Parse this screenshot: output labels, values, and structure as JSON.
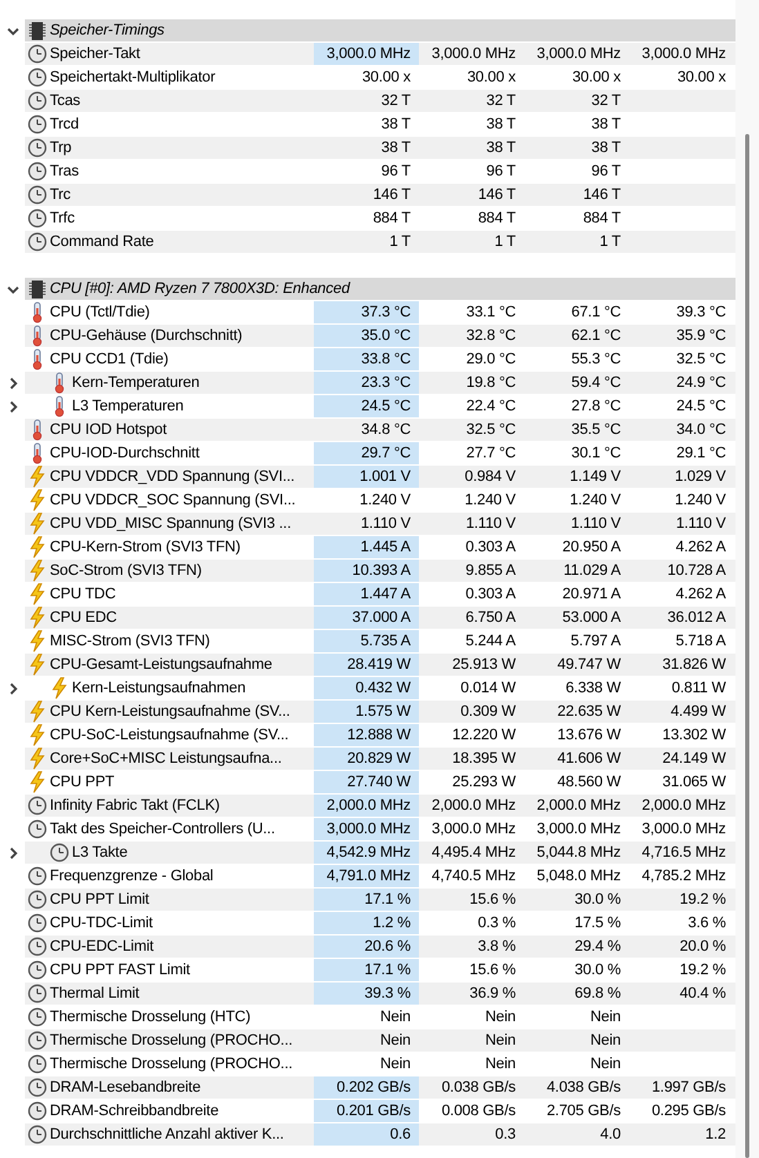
{
  "sections": [
    {
      "title": "Speicher-Timings",
      "expanded": true,
      "rows": [
        {
          "kind": "clock",
          "label": "Speicher-Takt",
          "highlighted": true,
          "values": [
            "3,000.0 MHz",
            "3,000.0 MHz",
            "3,000.0 MHz",
            "3,000.0 MHz"
          ]
        },
        {
          "kind": "clock",
          "label": "Speichertakt-Multiplikator",
          "highlighted": false,
          "values": [
            "30.00 x",
            "30.00 x",
            "30.00 x",
            "30.00 x"
          ]
        },
        {
          "kind": "clock",
          "label": "Tcas",
          "highlighted": false,
          "values": [
            "32 T",
            "32 T",
            "32 T"
          ]
        },
        {
          "kind": "clock",
          "label": "Trcd",
          "highlighted": false,
          "values": [
            "38 T",
            "38 T",
            "38 T"
          ]
        },
        {
          "kind": "clock",
          "label": "Trp",
          "highlighted": false,
          "values": [
            "38 T",
            "38 T",
            "38 T"
          ]
        },
        {
          "kind": "clock",
          "label": "Tras",
          "highlighted": false,
          "values": [
            "96 T",
            "96 T",
            "96 T"
          ]
        },
        {
          "kind": "clock",
          "label": "Trc",
          "highlighted": false,
          "values": [
            "146 T",
            "146 T",
            "146 T"
          ]
        },
        {
          "kind": "clock",
          "label": "Trfc",
          "highlighted": false,
          "values": [
            "884 T",
            "884 T",
            "884 T"
          ]
        },
        {
          "kind": "clock",
          "label": "Command Rate",
          "highlighted": false,
          "values": [
            "1 T",
            "1 T",
            "1 T"
          ]
        }
      ]
    },
    {
      "title": "CPU [#0]: AMD Ryzen 7 7800X3D: Enhanced",
      "expanded": true,
      "rows": [
        {
          "kind": "temp",
          "label": "CPU (Tctl/Tdie)",
          "highlighted": true,
          "values": [
            "37.3 °C",
            "33.1 °C",
            "67.1 °C",
            "39.3 °C"
          ]
        },
        {
          "kind": "temp",
          "label": "CPU-Gehäuse (Durchschnitt)",
          "highlighted": true,
          "values": [
            "35.0 °C",
            "32.8 °C",
            "62.1 °C",
            "35.9 °C"
          ]
        },
        {
          "kind": "temp",
          "label": "CPU CCD1 (Tdie)",
          "highlighted": true,
          "values": [
            "33.8 °C",
            "29.0 °C",
            "55.3 °C",
            "32.5 °C"
          ]
        },
        {
          "kind": "temp",
          "label": "Kern-Temperaturen",
          "highlighted": true,
          "expanded": false,
          "values": [
            "23.3 °C",
            "19.8 °C",
            "59.4 °C",
            "24.9 °C"
          ]
        },
        {
          "kind": "temp",
          "label": "L3 Temperaturen",
          "highlighted": true,
          "expanded": false,
          "values": [
            "24.5 °C",
            "22.4 °C",
            "27.8 °C",
            "24.5 °C"
          ]
        },
        {
          "kind": "temp",
          "label": "CPU IOD Hotspot",
          "highlighted": false,
          "values": [
            "34.8 °C",
            "32.5 °C",
            "35.5 °C",
            "34.0 °C"
          ]
        },
        {
          "kind": "temp",
          "label": "CPU-IOD-Durchschnitt",
          "highlighted": true,
          "values": [
            "29.7 °C",
            "27.7 °C",
            "30.1 °C",
            "29.1 °C"
          ]
        },
        {
          "kind": "power",
          "label": "CPU VDDCR_VDD Spannung (SVI...",
          "highlighted": true,
          "values": [
            "1.001 V",
            "0.984 V",
            "1.149 V",
            "1.029 V"
          ]
        },
        {
          "kind": "power",
          "label": "CPU VDDCR_SOC Spannung (SVI...",
          "highlighted": false,
          "values": [
            "1.240 V",
            "1.240 V",
            "1.240 V",
            "1.240 V"
          ]
        },
        {
          "kind": "power",
          "label": "CPU VDD_MISC Spannung (SVI3 ...",
          "highlighted": false,
          "values": [
            "1.110 V",
            "1.110 V",
            "1.110 V",
            "1.110 V"
          ]
        },
        {
          "kind": "power",
          "label": "CPU-Kern-Strom (SVI3 TFN)",
          "highlighted": true,
          "values": [
            "1.445 A",
            "0.303 A",
            "20.950 A",
            "4.262 A"
          ]
        },
        {
          "kind": "power",
          "label": "SoC-Strom (SVI3 TFN)",
          "highlighted": true,
          "values": [
            "10.393 A",
            "9.855 A",
            "11.029 A",
            "10.728 A"
          ]
        },
        {
          "kind": "power",
          "label": "CPU TDC",
          "highlighted": true,
          "values": [
            "1.447 A",
            "0.303 A",
            "20.971 A",
            "4.262 A"
          ]
        },
        {
          "kind": "power",
          "label": "CPU EDC",
          "highlighted": true,
          "values": [
            "37.000 A",
            "6.750 A",
            "53.000 A",
            "36.012 A"
          ]
        },
        {
          "kind": "power",
          "label": "MISC-Strom (SVI3 TFN)",
          "highlighted": true,
          "values": [
            "5.735 A",
            "5.244 A",
            "5.797 A",
            "5.718 A"
          ]
        },
        {
          "kind": "power",
          "label": "CPU-Gesamt-Leistungsaufnahme",
          "highlighted": true,
          "values": [
            "28.419 W",
            "25.913 W",
            "49.747 W",
            "31.826 W"
          ]
        },
        {
          "kind": "power",
          "label": "Kern-Leistungsaufnahmen",
          "highlighted": true,
          "expanded": false,
          "values": [
            "0.432 W",
            "0.014 W",
            "6.338 W",
            "0.811 W"
          ]
        },
        {
          "kind": "power",
          "label": "CPU Kern-Leistungsaufnahme (SV...",
          "highlighted": true,
          "values": [
            "1.575 W",
            "0.309 W",
            "22.635 W",
            "4.499 W"
          ]
        },
        {
          "kind": "power",
          "label": "CPU-SoC-Leistungsaufnahme (SV...",
          "highlighted": true,
          "values": [
            "12.888 W",
            "12.220 W",
            "13.676 W",
            "13.302 W"
          ]
        },
        {
          "kind": "power",
          "label": "Core+SoC+MISC Leistungsaufna...",
          "highlighted": true,
          "values": [
            "20.829 W",
            "18.395 W",
            "41.606 W",
            "24.149 W"
          ]
        },
        {
          "kind": "power",
          "label": "CPU PPT",
          "highlighted": true,
          "values": [
            "27.740 W",
            "25.293 W",
            "48.560 W",
            "31.065 W"
          ]
        },
        {
          "kind": "clock",
          "label": "Infinity Fabric Takt (FCLK)",
          "highlighted": true,
          "values": [
            "2,000.0 MHz",
            "2,000.0 MHz",
            "2,000.0 MHz",
            "2,000.0 MHz"
          ]
        },
        {
          "kind": "clock",
          "label": "Takt des Speicher-Controllers (U...",
          "highlighted": true,
          "values": [
            "3,000.0 MHz",
            "3,000.0 MHz",
            "3,000.0 MHz",
            "3,000.0 MHz"
          ]
        },
        {
          "kind": "clock",
          "label": "L3 Takte",
          "highlighted": true,
          "expanded": false,
          "values": [
            "4,542.9 MHz",
            "4,495.4 MHz",
            "5,044.8 MHz",
            "4,716.5 MHz"
          ]
        },
        {
          "kind": "clock",
          "label": "Frequenzgrenze - Global",
          "highlighted": true,
          "values": [
            "4,791.0 MHz",
            "4,740.5 MHz",
            "5,048.0 MHz",
            "4,785.2 MHz"
          ]
        },
        {
          "kind": "clock",
          "label": "CPU PPT Limit",
          "highlighted": true,
          "values": [
            "17.1 %",
            "15.6 %",
            "30.0 %",
            "19.2 %"
          ]
        },
        {
          "kind": "clock",
          "label": "CPU-TDC-Limit",
          "highlighted": true,
          "values": [
            "1.2 %",
            "0.3 %",
            "17.5 %",
            "3.6 %"
          ]
        },
        {
          "kind": "clock",
          "label": "CPU-EDC-Limit",
          "highlighted": true,
          "values": [
            "20.6 %",
            "3.8 %",
            "29.4 %",
            "20.0 %"
          ]
        },
        {
          "kind": "clock",
          "label": "CPU PPT FAST Limit",
          "highlighted": true,
          "values": [
            "17.1 %",
            "15.6 %",
            "30.0 %",
            "19.2 %"
          ]
        },
        {
          "kind": "clock",
          "label": "Thermal Limit",
          "highlighted": true,
          "values": [
            "39.3 %",
            "36.9 %",
            "69.8 %",
            "40.4 %"
          ]
        },
        {
          "kind": "clock",
          "label": "Thermische Drosselung (HTC)",
          "highlighted": false,
          "values": [
            "Nein",
            "Nein",
            "Nein"
          ]
        },
        {
          "kind": "clock",
          "label": "Thermische Drosselung (PROCHO...",
          "highlighted": false,
          "values": [
            "Nein",
            "Nein",
            "Nein"
          ]
        },
        {
          "kind": "clock",
          "label": "Thermische Drosselung (PROCHO...",
          "highlighted": false,
          "values": [
            "Nein",
            "Nein",
            "Nein"
          ]
        },
        {
          "kind": "clock",
          "label": "DRAM-Lesebandbreite",
          "highlighted": true,
          "values": [
            "0.202 GB/s",
            "0.038 GB/s",
            "4.038 GB/s",
            "1.997 GB/s"
          ]
        },
        {
          "kind": "clock",
          "label": "DRAM-Schreibbandbreite",
          "highlighted": true,
          "values": [
            "0.201 GB/s",
            "0.008 GB/s",
            "2.705 GB/s",
            "0.295 GB/s"
          ]
        },
        {
          "kind": "clock",
          "label": "Durchschnittliche Anzahl aktiver K...",
          "highlighted": true,
          "values": [
            "0.6",
            "0.3",
            "4.0",
            "1.2"
          ]
        }
      ]
    }
  ]
}
